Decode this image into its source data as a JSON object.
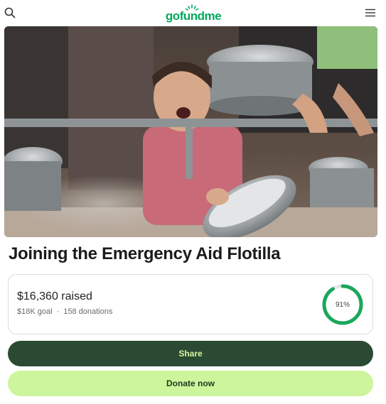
{
  "header": {
    "logo_text": "gofundme",
    "icons": {
      "search": "search-icon",
      "menu": "hamburger-menu-icon"
    },
    "brand_color": "#02a95c"
  },
  "campaign": {
    "title": "Joining the Emergency Aid Flotilla",
    "raised_text": "$16,360 raised",
    "goal_text": "$18K goal",
    "donations_text": "158 donations",
    "separator": "·",
    "progress_percent": 91,
    "progress_label": "91%"
  },
  "actions": {
    "share_label": "Share",
    "donate_label": "Donate now"
  },
  "colors": {
    "share_bg": "#2b4a33",
    "share_text": "#d8f5a2",
    "donate_bg": "#cdf59b",
    "donate_text": "#1f3a22",
    "progress": "#1aa75a"
  }
}
